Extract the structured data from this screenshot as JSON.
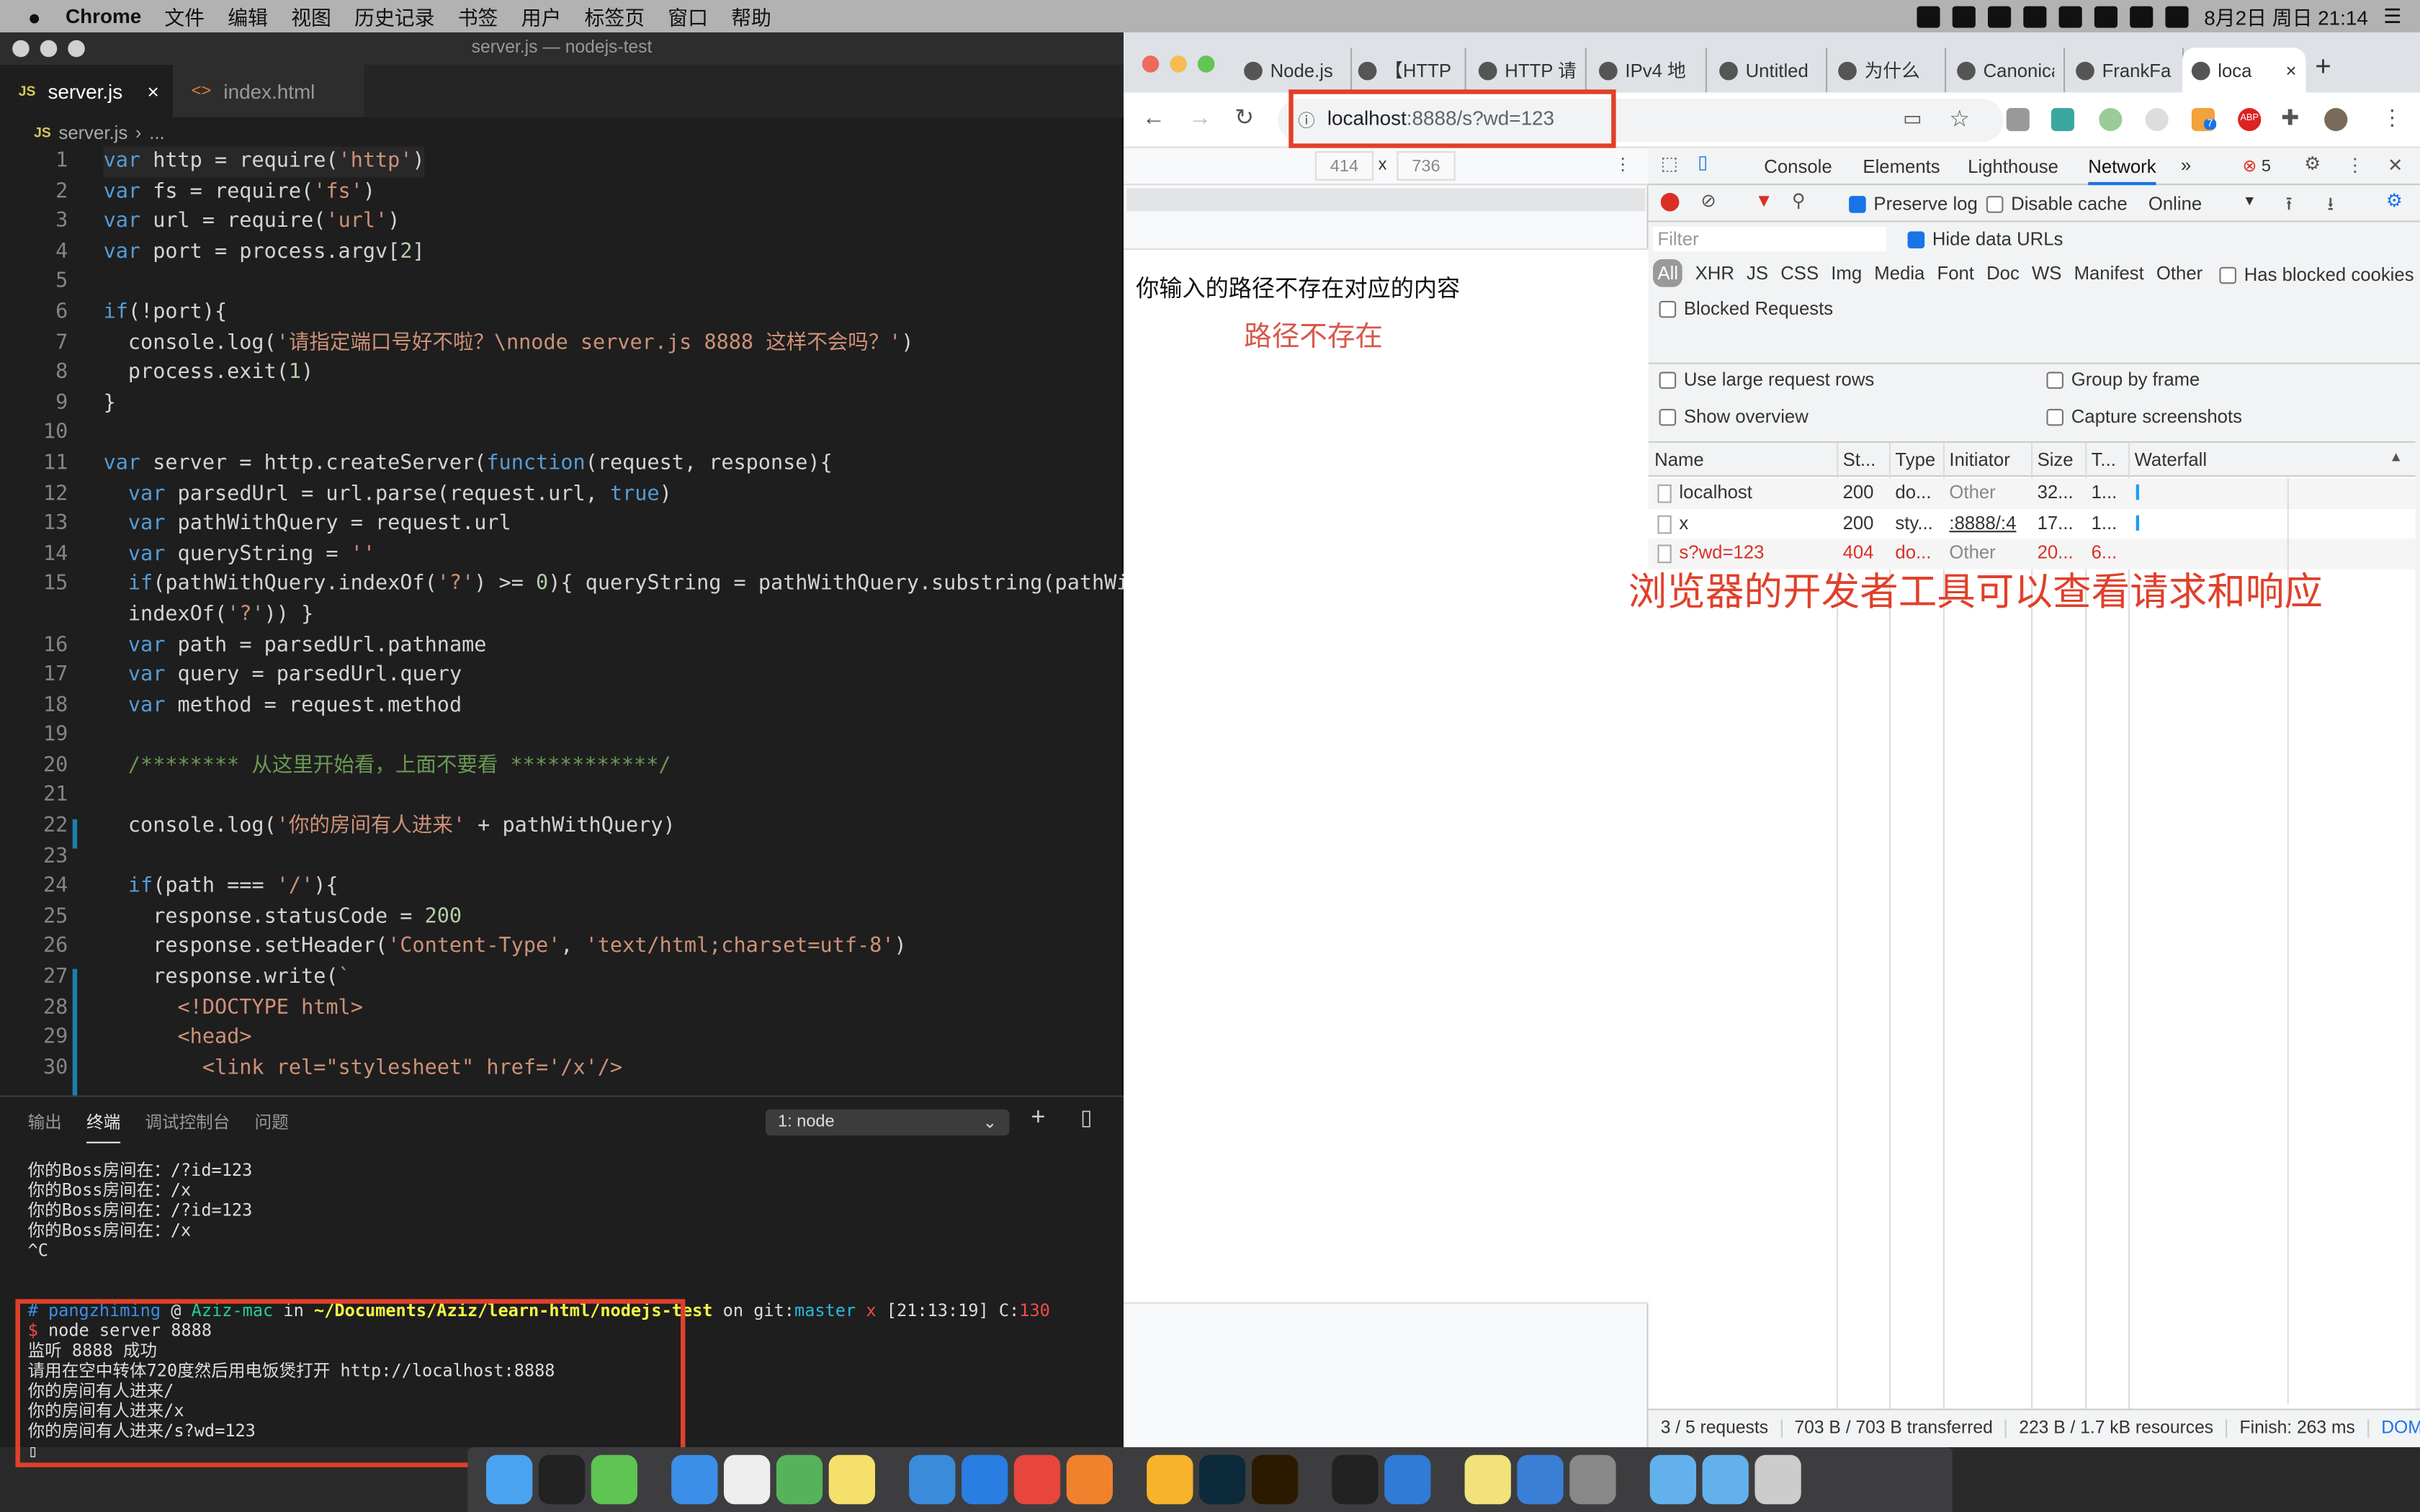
{
  "menubar": {
    "app": "Chrome",
    "items": [
      "文件",
      "编辑",
      "视图",
      "历史记录",
      "书签",
      "用户",
      "标签页",
      "窗口",
      "帮助"
    ],
    "clock": "8月2日 周日 21:14",
    "status_icons": [
      "archive-icon",
      "feather-icon",
      "app-icon",
      "wechat-icon",
      "capture-icon",
      "bluetooth-icon",
      "s-icon",
      "more-icon"
    ]
  },
  "vscode": {
    "title": "server.js — nodejs-test",
    "tabs": [
      {
        "label": "server.js",
        "icon": "JS",
        "close": "×"
      },
      {
        "label": "index.html",
        "icon": "<>"
      }
    ],
    "breadcrumb": {
      "file": "server.js",
      "sep": "›",
      "rest": "..."
    },
    "code": [
      {
        "n": "1",
        "t": [
          [
            "k",
            "var"
          ],
          [
            "p",
            " http = require("
          ],
          [
            "s",
            "'http'"
          ],
          [
            "p",
            ")"
          ]
        ]
      },
      {
        "n": "2",
        "t": [
          [
            "k",
            "var"
          ],
          [
            "p",
            " fs = require("
          ],
          [
            "s",
            "'fs'"
          ],
          [
            "p",
            ")"
          ]
        ]
      },
      {
        "n": "3",
        "t": [
          [
            "k",
            "var"
          ],
          [
            "p",
            " url = require("
          ],
          [
            "s",
            "'url'"
          ],
          [
            "p",
            ")"
          ]
        ]
      },
      {
        "n": "4",
        "t": [
          [
            "k",
            "var"
          ],
          [
            "p",
            " port = process.argv["
          ],
          [
            "n",
            "2"
          ],
          [
            "p",
            "]"
          ]
        ]
      },
      {
        "n": "5",
        "t": []
      },
      {
        "n": "6",
        "t": [
          [
            "k",
            "if"
          ],
          [
            "p",
            "(!port){"
          ]
        ]
      },
      {
        "n": "7",
        "t": [
          [
            "p",
            "  console.log("
          ],
          [
            "s",
            "'请指定端口号好不啦？\\nnode server.js 8888 这样不会吗？'"
          ],
          [
            "p",
            ")"
          ]
        ]
      },
      {
        "n": "8",
        "t": [
          [
            "p",
            "  process.exit("
          ],
          [
            "n",
            "1"
          ],
          [
            "p",
            ")"
          ]
        ]
      },
      {
        "n": "9",
        "t": [
          [
            "p",
            "}"
          ]
        ]
      },
      {
        "n": "10",
        "t": []
      },
      {
        "n": "11",
        "t": [
          [
            "k",
            "var"
          ],
          [
            "p",
            " server = http.createServer("
          ],
          [
            "k",
            "function"
          ],
          [
            "p",
            "(request, response){"
          ]
        ]
      },
      {
        "n": "12",
        "t": [
          [
            "p",
            "  "
          ],
          [
            "k",
            "var"
          ],
          [
            "p",
            " parsedUrl = url.parse(request.url, "
          ],
          [
            "k",
            "true"
          ],
          [
            "p",
            ")"
          ]
        ]
      },
      {
        "n": "13",
        "t": [
          [
            "p",
            "  "
          ],
          [
            "k",
            "var"
          ],
          [
            "p",
            " pathWithQuery = request.url"
          ]
        ]
      },
      {
        "n": "14",
        "t": [
          [
            "p",
            "  "
          ],
          [
            "k",
            "var"
          ],
          [
            "p",
            " queryString = "
          ],
          [
            "s",
            "''"
          ]
        ]
      },
      {
        "n": "15",
        "t": [
          [
            "p",
            "  "
          ],
          [
            "k",
            "if"
          ],
          [
            "p",
            "(pathWithQuery.indexOf("
          ],
          [
            "s",
            "'?'"
          ],
          [
            "p",
            ") >= "
          ],
          [
            "n",
            "0"
          ],
          [
            "p",
            "){ queryString = pathWithQuery.substring(pathWith"
          ]
        ]
      },
      {
        "n": "",
        "t": [
          [
            "p",
            "  indexOf("
          ],
          [
            "s",
            "'?'"
          ],
          [
            "p",
            ")) }"
          ]
        ]
      },
      {
        "n": "16",
        "t": [
          [
            "p",
            "  "
          ],
          [
            "k",
            "var"
          ],
          [
            "p",
            " path = parsedUrl.pathname"
          ]
        ]
      },
      {
        "n": "17",
        "t": [
          [
            "p",
            "  "
          ],
          [
            "k",
            "var"
          ],
          [
            "p",
            " query = parsedUrl.query"
          ]
        ]
      },
      {
        "n": "18",
        "t": [
          [
            "p",
            "  "
          ],
          [
            "k",
            "var"
          ],
          [
            "p",
            " method = request.method"
          ]
        ]
      },
      {
        "n": "19",
        "t": []
      },
      {
        "n": "20",
        "t": [
          [
            "p",
            "  "
          ],
          [
            "c",
            "/******** 从这里开始看，上面不要看 ************/"
          ]
        ]
      },
      {
        "n": "21",
        "t": []
      },
      {
        "n": "22",
        "t": [
          [
            "p",
            "  console.log("
          ],
          [
            "s",
            "'你的房间有人进来'"
          ],
          [
            "p",
            " + pathWithQuery)"
          ]
        ]
      },
      {
        "n": "23",
        "t": []
      },
      {
        "n": "24",
        "t": [
          [
            "p",
            "  "
          ],
          [
            "k",
            "if"
          ],
          [
            "p",
            "(path === "
          ],
          [
            "s",
            "'/'"
          ],
          [
            "p",
            "){"
          ]
        ]
      },
      {
        "n": "25",
        "t": [
          [
            "p",
            "    response.statusCode = "
          ],
          [
            "n",
            "200"
          ]
        ]
      },
      {
        "n": "26",
        "t": [
          [
            "p",
            "    response.setHeader("
          ],
          [
            "s",
            "'Content-Type'"
          ],
          [
            "p",
            ", "
          ],
          [
            "s",
            "'text/html;charset=utf-8'"
          ],
          [
            "p",
            ")"
          ]
        ]
      },
      {
        "n": "27",
        "t": [
          [
            "p",
            "    response.write("
          ],
          [
            "s",
            "`"
          ]
        ]
      },
      {
        "n": "28",
        "t": [
          [
            "p",
            "      "
          ],
          [
            "s",
            "<!DOCTYPE html>"
          ]
        ]
      },
      {
        "n": "29",
        "t": [
          [
            "p",
            "      "
          ],
          [
            "s",
            "<head>"
          ]
        ]
      },
      {
        "n": "30",
        "t": [
          [
            "p",
            "        "
          ],
          [
            "s",
            "<link rel=\"stylesheet\" href='/x'/>"
          ]
        ]
      }
    ],
    "panel": {
      "tabs": [
        "输出",
        "终端",
        "调试控制台",
        "问题"
      ],
      "active_tab": "终端",
      "terminal_select": "1: node",
      "add": "+",
      "split": "▯"
    },
    "terminal": [
      [
        [
          "#ddd",
          "你的Boss房间在：/?id=123"
        ]
      ],
      [
        [
          "#ddd",
          "你的Boss房间在：/x"
        ]
      ],
      [
        [
          "#ddd",
          "你的Boss房间在：/?id=123"
        ]
      ],
      [
        [
          "#ddd",
          "你的Boss房间在：/x"
        ]
      ],
      [
        [
          "#ddd",
          "^C"
        ]
      ],
      [],
      [
        [
          "#3b8eea",
          "# "
        ],
        [
          "#3b8eea",
          "pangzhiming"
        ],
        [
          "#ddd",
          " @ "
        ],
        [
          "#23d18b",
          "Aziz-mac"
        ],
        [
          "#ddd",
          " in "
        ],
        [
          "#f5f543",
          "~/Documents/Aziz/learn-html/nodejs-test"
        ],
        [
          "#ddd",
          " on git:"
        ],
        [
          "#29b8db",
          "master"
        ],
        [
          "#f14c4c",
          " x"
        ],
        [
          "#ddd",
          " [21:13:19] C:"
        ],
        [
          "#f14c4c",
          "130"
        ]
      ],
      [
        [
          "#f14c4c",
          "$ "
        ],
        [
          "#ddd",
          "node server 8888"
        ]
      ],
      [
        [
          "#ddd",
          "监听 8888 成功"
        ]
      ],
      [
        [
          "#ddd",
          "请用在空中转体720度然后用电饭煲打开 http://localhost:8888"
        ]
      ],
      [
        [
          "#ddd",
          "你的房间有人进来/"
        ]
      ],
      [
        [
          "#ddd",
          "你的房间有人进来/x"
        ]
      ],
      [
        [
          "#ddd",
          "你的房间有人进来/s?wd=123"
        ]
      ],
      [
        [
          "#ddd",
          "▯"
        ]
      ]
    ]
  },
  "chrome": {
    "tabs": [
      "Node.js",
      "【HTTP",
      "HTTP 请",
      "IPv4 地",
      "Untitled",
      "为什么",
      "Canonical",
      "FrankFa",
      "loca"
    ],
    "active_close": "×",
    "new_tab": "+",
    "url": {
      "host": "localhost",
      "rest": ":8888/s?wd=123"
    },
    "device": {
      "width": "414",
      "x": "x",
      "height": "736"
    },
    "page": {
      "message": "你输入的路径不存在对应的内容",
      "note": "路径不存在"
    },
    "extension_badge": "7",
    "abp": "ABP"
  },
  "devtools": {
    "tabs": [
      "Console",
      "Elements",
      "Lighthouse",
      "Network"
    ],
    "active": "Network",
    "more": "»",
    "errors": "5",
    "toolbar": {
      "preserve_log": "Preserve log",
      "preserve_checked": true,
      "disable_cache": "Disable cache",
      "throttle": "Online"
    },
    "filter_placeholder": "Filter",
    "hide_data_urls": "Hide data URLs",
    "types": [
      "All",
      "XHR",
      "JS",
      "CSS",
      "Img",
      "Media",
      "Font",
      "Doc",
      "WS",
      "Manifest",
      "Other"
    ],
    "has_blocked_cookies": "Has blocked cookies",
    "blocked_requests": "Blocked Requests",
    "options": [
      "Use large request rows",
      "Group by frame",
      "Show overview",
      "Capture screenshots"
    ],
    "columns": [
      "Name",
      "St...",
      "Type",
      "Initiator",
      "Size",
      "T...",
      "Waterfall"
    ],
    "rows": [
      {
        "name": "localhost",
        "status": "200",
        "type": "do...",
        "initiator": "Other",
        "size": "32...",
        "time": "1...",
        "error": false
      },
      {
        "name": "x",
        "status": "200",
        "type": "sty...",
        "initiator": ":8888/:4",
        "size": "17...",
        "time": "1...",
        "error": false
      },
      {
        "name": "s?wd=123",
        "status": "404",
        "type": "do...",
        "initiator": "Other",
        "size": "20...",
        "time": "6...",
        "error": true
      }
    ],
    "footer": [
      "3 / 5 requests",
      "703 B / 703 B transferred",
      "223 B / 1.7 kB resources",
      "Finish: 263 ms",
      "DOM"
    ]
  },
  "annotation": "浏览器的开发者工具可以查看请求和响应",
  "dock": [
    "finder",
    "qq",
    "wechat",
    "feishu",
    "typora",
    "evernote",
    "notes",
    "keynote",
    "browser",
    "chrome",
    "firefox",
    "sketch",
    "photoshop",
    "illustrator",
    "terminal",
    "vscode",
    "stickies",
    "preview",
    "photo-booth",
    "folder",
    "downloads",
    "trash"
  ],
  "colors": {
    "accent": "#1a73e8",
    "annotation": "#e0402a",
    "error": "#d93025"
  }
}
